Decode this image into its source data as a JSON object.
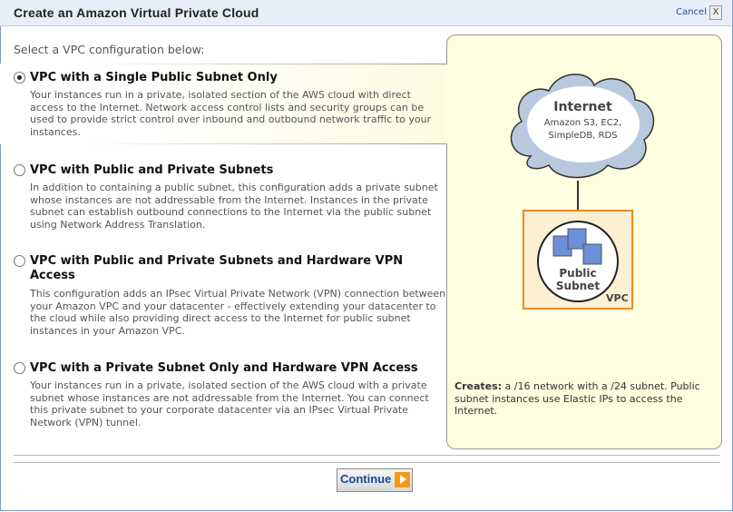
{
  "header": {
    "title": "Create an Amazon Virtual Private Cloud",
    "cancel_label": "Cancel",
    "close_label": "X"
  },
  "intro": "Select a VPC configuration below:",
  "options": [
    {
      "label": "VPC with a Single Public Subnet Only",
      "selected": true,
      "description": "Your instances run in a private, isolated section of the AWS cloud with direct access to the Internet. Network access control lists and security groups can be used to provide strict control over inbound and outbound network traffic to your instances."
    },
    {
      "label": "VPC with Public and Private Subnets",
      "selected": false,
      "description": "In addition to containing a public subnet, this configuration adds a private subnet whose instances are not addressable from the Internet. Instances in the private subnet can establish outbound connections to the Internet via the public subnet using Network Address Translation."
    },
    {
      "label": "VPC with Public and Private Subnets and Hardware VPN Access",
      "selected": false,
      "description": "This configuration adds an IPsec Virtual Private Network (VPN) connection between your Amazon VPC and your datacenter - effectively extending your datacenter to the cloud while also providing direct access to the Internet for public subnet instances in your Amazon VPC."
    },
    {
      "label": "VPC with a Private Subnet Only and Hardware VPN Access",
      "selected": false,
      "description": "Your instances run in a private, isolated section of the AWS cloud with a private subnet whose instances are not addressable from the Internet. You can connect this private subnet to your corporate datacenter via an IPsec Virtual Private Network (VPN) tunnel."
    }
  ],
  "diagram": {
    "cloud_title": "Internet",
    "cloud_line1": "Amazon S3, EC2,",
    "cloud_line2": "SimpleDB, RDS",
    "subnet_line1": "Public",
    "subnet_line2": "Subnet",
    "vpc_label": "VPC"
  },
  "creates": {
    "label": "Creates:",
    "text": " a /16 network with a /24 subnet. Public subnet instances use Elastic IPs to access the Internet."
  },
  "continue_label": "Continue"
}
